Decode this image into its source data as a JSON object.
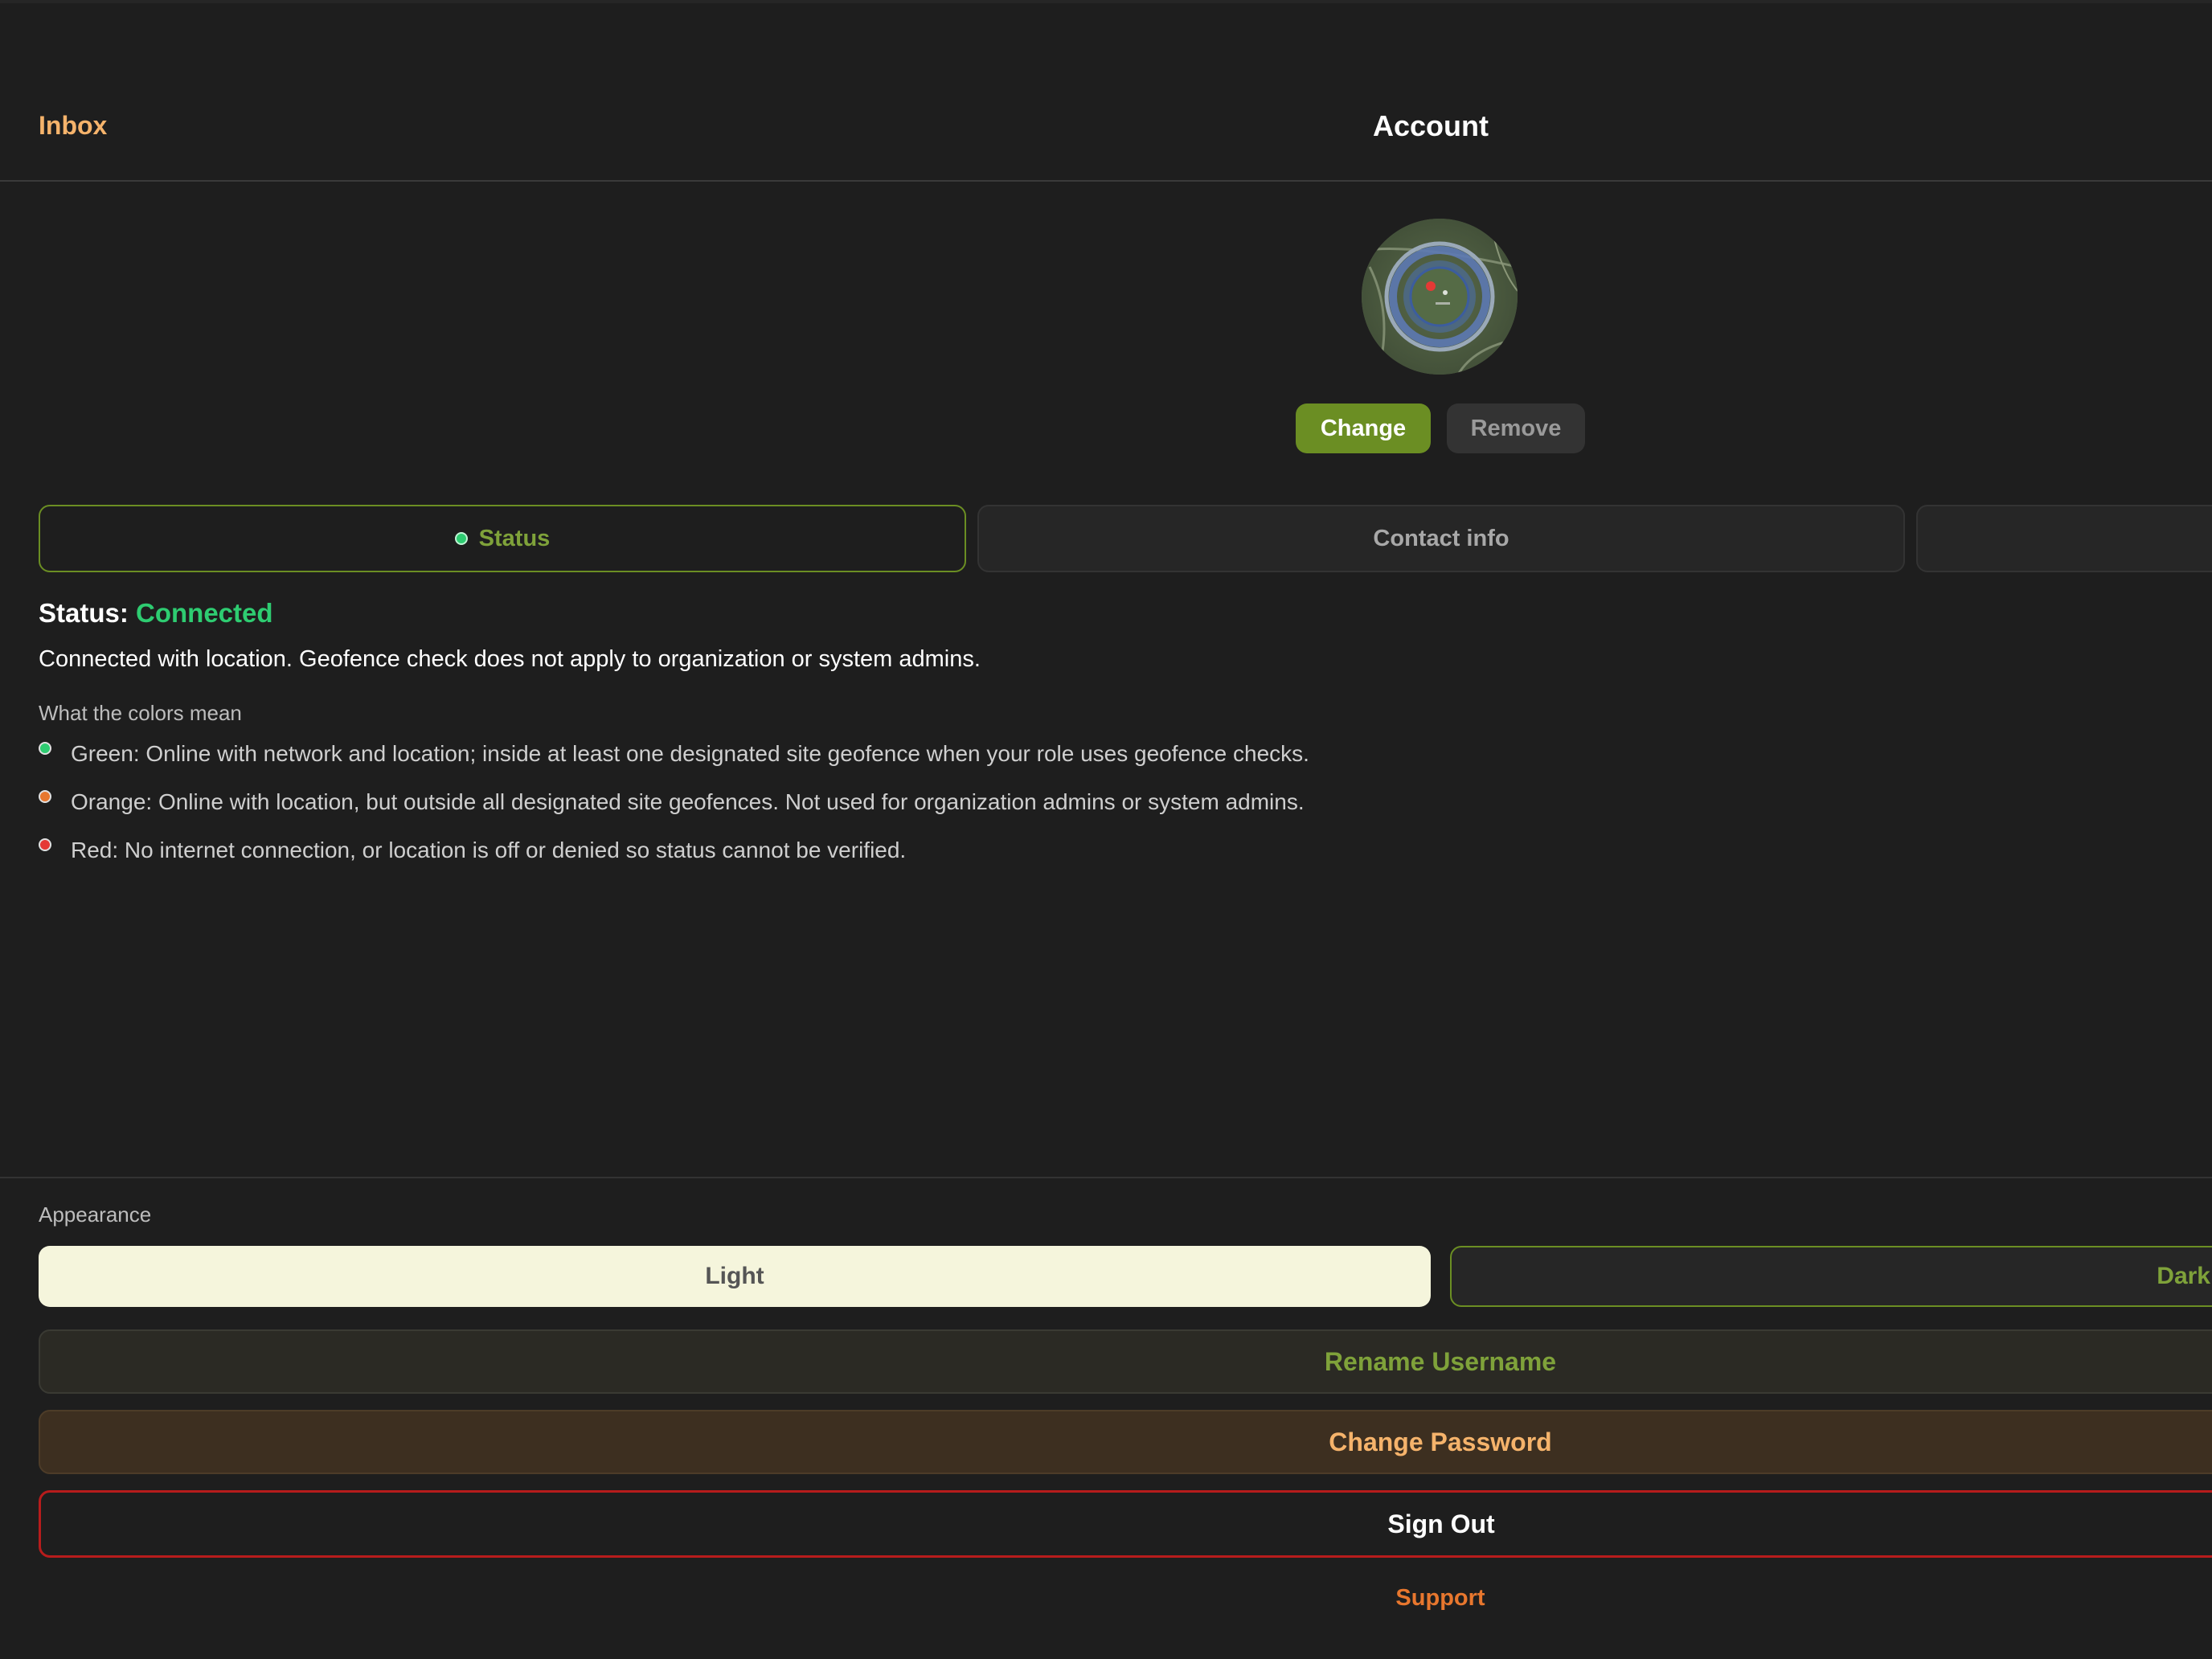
{
  "header": {
    "back_label": "Inbox",
    "title": "Account"
  },
  "avatar": {
    "change_label": "Change",
    "remove_label": "Remove"
  },
  "tabs": [
    {
      "label": "Status",
      "active": true
    },
    {
      "label": "Contact info",
      "active": false
    },
    {
      "label": "",
      "active": false
    }
  ],
  "status": {
    "prefix": "Status:",
    "value": "Connected",
    "description": "Connected with location. Geofence check does not apply to organization or system admins."
  },
  "legend": {
    "title": "What the colors mean",
    "items": [
      {
        "color": "#2ecc71",
        "text": "Green: Online with network and location; inside at least one designated site geofence when your role uses geofence checks."
      },
      {
        "color": "#e8772e",
        "text": "Orange: Online with location, but outside all designated site geofences. Not used for organization admins or system admins."
      },
      {
        "color": "#e53935",
        "text": "Red: No internet connection, or location is off or denied so status cannot be verified."
      }
    ]
  },
  "appearance": {
    "label": "Appearance",
    "light_label": "Light",
    "dark_label": "Dark",
    "selected": "Dark"
  },
  "actions": {
    "rename_label": "Rename Username",
    "password_label": "Change Password",
    "signout_label": "Sign Out",
    "support_label": "Support"
  },
  "colors": {
    "accent_green": "#6b8e23",
    "accent_orange": "#f5b36b",
    "danger": "#b71c1c",
    "connected": "#2ecc71"
  }
}
